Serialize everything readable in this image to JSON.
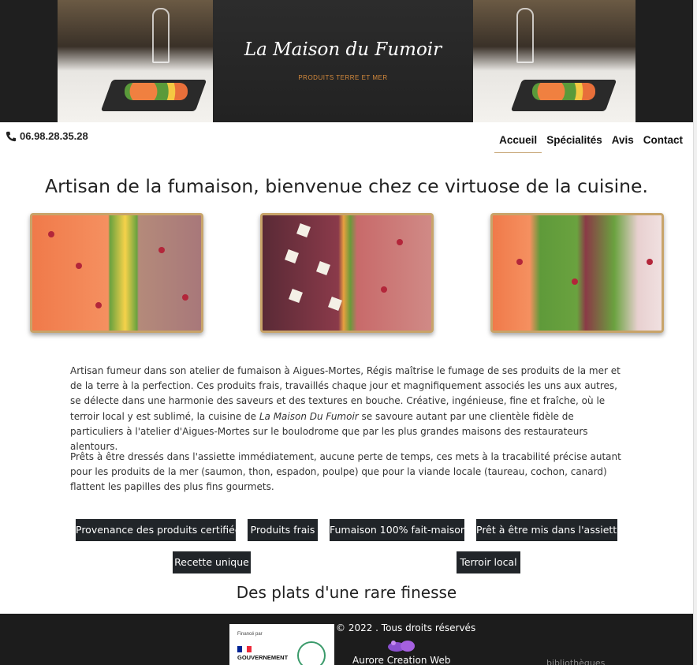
{
  "header": {
    "brand_title": "La Maison du Fumoir",
    "brand_subtitle": "PRODUITS TERRE ET MER"
  },
  "contact": {
    "phone": "06.98.28.35.28",
    "phone_icon": "phone-icon"
  },
  "nav": {
    "items": [
      {
        "label": "Accueil",
        "active": true
      },
      {
        "label": "Spécialités",
        "active": false
      },
      {
        "label": "Avis",
        "active": false
      },
      {
        "label": "Contact",
        "active": false
      }
    ]
  },
  "main": {
    "headline": "Artisan de la fumaison, bienvenue chez ce virtuose de la cuisine.",
    "paragraph_1_before": "Artisan fumeur dans son atelier de fumaison à Aigues-Mortes, Régis maîtrise le fumage de ses produits de la mer et de la terre à la perfection. Ces produits frais, travaillés chaque jour et magnifiquement associés les uns aux autres, se délecte dans une harmonie des saveurs et des textures en bouche. Créative, ingénieuse, fine et fraîche, où le terroir local y est sublimé, la cuisine de ",
    "paragraph_1_italic": "La Maison Du Fumoir",
    "paragraph_1_after": " se savoure autant par une clientèle fidèle de particuliers à l'atelier d'Aigues-Mortes sur le boulodrome que par les plus grandes maisons des restaurateurs alentours.",
    "paragraph_2": "Prêts à être dressés dans l'assiette immédiatement, aucune perte de temps, ces mets à la tracabilité précise autant pour les produits de la mer (saumon, thon, espadon, poulpe) que pour la viande locale (taureau, cochon, canard) flattent les papilles des plus fins gourmets.",
    "tags": [
      "Provenance des produits certifiée",
      "Produits frais",
      "Fumaison 100% fait-maison",
      "Prêt à être mis dans l'assiette",
      "Recette unique",
      "Terroir local"
    ],
    "section_title": "Des plats d'une rare finesse"
  },
  "footer": {
    "copyright": "© 2022 . Tous droits réservés",
    "gov_small": "Financé par",
    "gov_label": "GOUVERNEMENT",
    "credit": "Aurore Creation Web",
    "partial_text": "bibliothèques"
  },
  "colors": {
    "banner_bg": "#1f1f1f",
    "brand_subtitle": "#d58a3c",
    "tag_bg": "#212529",
    "footer_bg": "#1c1c1c",
    "nav_active_underline": "#c9a97a"
  }
}
